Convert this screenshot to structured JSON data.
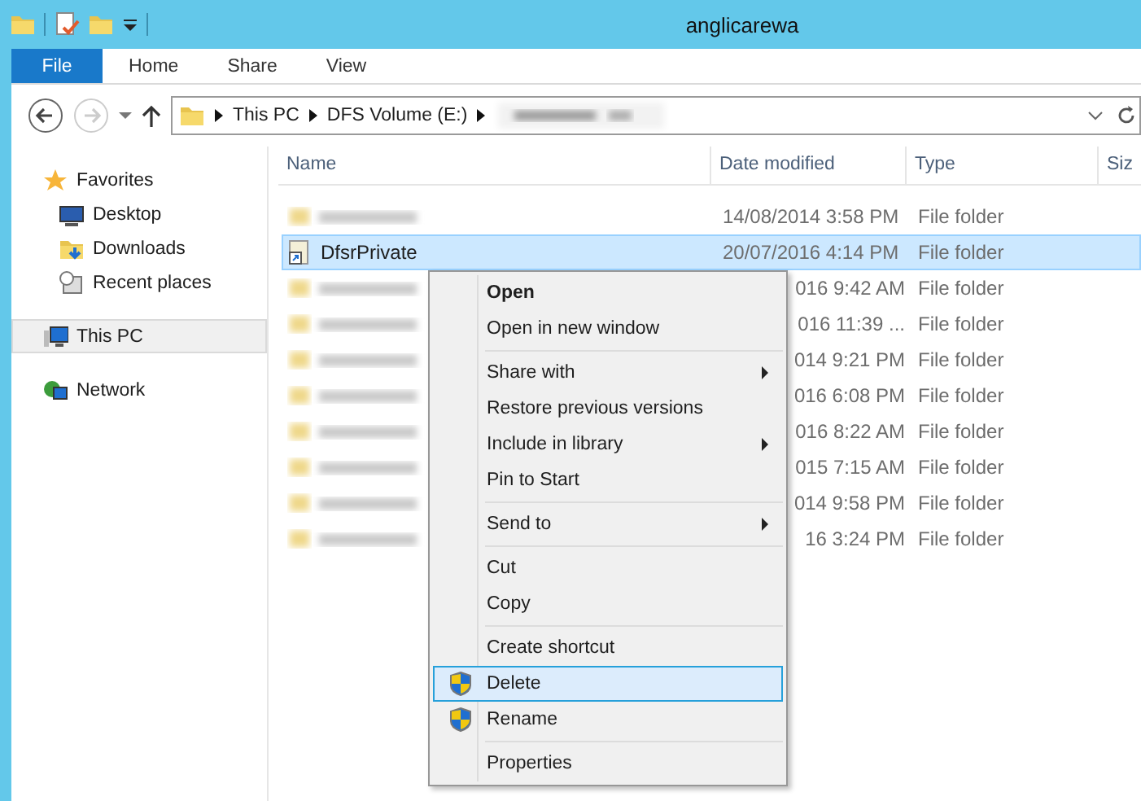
{
  "window": {
    "title": "anglicarewa"
  },
  "ribbon_tabs": [
    {
      "label": "File",
      "kind": "file",
      "selected": false
    },
    {
      "label": "Home",
      "kind": "tab",
      "selected": false
    },
    {
      "label": "Share",
      "kind": "tab",
      "selected": false
    },
    {
      "label": "View",
      "kind": "tab",
      "selected": false
    }
  ],
  "address_bar": {
    "crumbs": [
      "This PC",
      "DFS Volume (E:)"
    ]
  },
  "navigation": [
    {
      "label": "Favorites",
      "selected": false,
      "children": [
        {
          "label": "Desktop",
          "selected": false
        },
        {
          "label": "Downloads",
          "selected": false
        },
        {
          "label": "Recent places",
          "selected": false
        }
      ]
    },
    {
      "label": "This PC",
      "selected": true
    },
    {
      "label": "Network",
      "selected": false
    }
  ],
  "table": {
    "columns": [
      "Name",
      "Date modified",
      "Type",
      "Siz"
    ],
    "rows": [
      {
        "date": "14/08/2014 3:58 PM",
        "type": "File folder",
        "selected": false
      },
      {
        "name": "DfsrPrivate",
        "date": "20/07/2016 4:14 PM",
        "type": "File folder",
        "selected": true
      },
      {
        "date": "016 9:42 AM",
        "type": "File folder",
        "selected": false
      },
      {
        "date": "016 11:39 ...",
        "type": "File folder",
        "selected": false
      },
      {
        "date": "014 9:21 PM",
        "type": "File folder",
        "selected": false
      },
      {
        "date": "016 6:08 PM",
        "type": "File folder",
        "selected": false
      },
      {
        "date": "016 8:22 AM",
        "type": "File folder",
        "selected": false
      },
      {
        "date": "015 7:15 AM",
        "type": "File folder",
        "selected": false
      },
      {
        "date": "014 9:58 PM",
        "type": "File folder",
        "selected": false
      },
      {
        "date": "16 3:24 PM",
        "type": "File folder",
        "selected": false
      }
    ]
  },
  "context_menu": [
    [
      {
        "label": "Open",
        "bold": true,
        "submenu": false,
        "shield": false,
        "selected": false
      },
      {
        "label": "Open in new window",
        "bold": false,
        "submenu": false,
        "shield": false,
        "selected": false
      }
    ],
    [
      {
        "label": "Share with",
        "bold": false,
        "submenu": true,
        "shield": false,
        "selected": false
      },
      {
        "label": "Restore previous versions",
        "bold": false,
        "submenu": false,
        "shield": false,
        "selected": false
      },
      {
        "label": "Include in library",
        "bold": false,
        "submenu": true,
        "shield": false,
        "selected": false
      },
      {
        "label": "Pin to Start",
        "bold": false,
        "submenu": false,
        "shield": false,
        "selected": false
      }
    ],
    [
      {
        "label": "Send to",
        "bold": false,
        "submenu": true,
        "shield": false,
        "selected": false
      }
    ],
    [
      {
        "label": "Cut",
        "bold": false,
        "submenu": false,
        "shield": false,
        "selected": false
      },
      {
        "label": "Copy",
        "bold": false,
        "submenu": false,
        "shield": false,
        "selected": false
      }
    ],
    [
      {
        "label": "Create shortcut",
        "bold": false,
        "submenu": false,
        "shield": false,
        "selected": false
      },
      {
        "label": "Delete",
        "bold": false,
        "submenu": false,
        "shield": true,
        "selected": true
      },
      {
        "label": "Rename",
        "bold": false,
        "submenu": false,
        "shield": true,
        "selected": false
      }
    ],
    [
      {
        "label": "Properties",
        "bold": false,
        "submenu": false,
        "shield": false,
        "selected": false
      }
    ]
  ]
}
